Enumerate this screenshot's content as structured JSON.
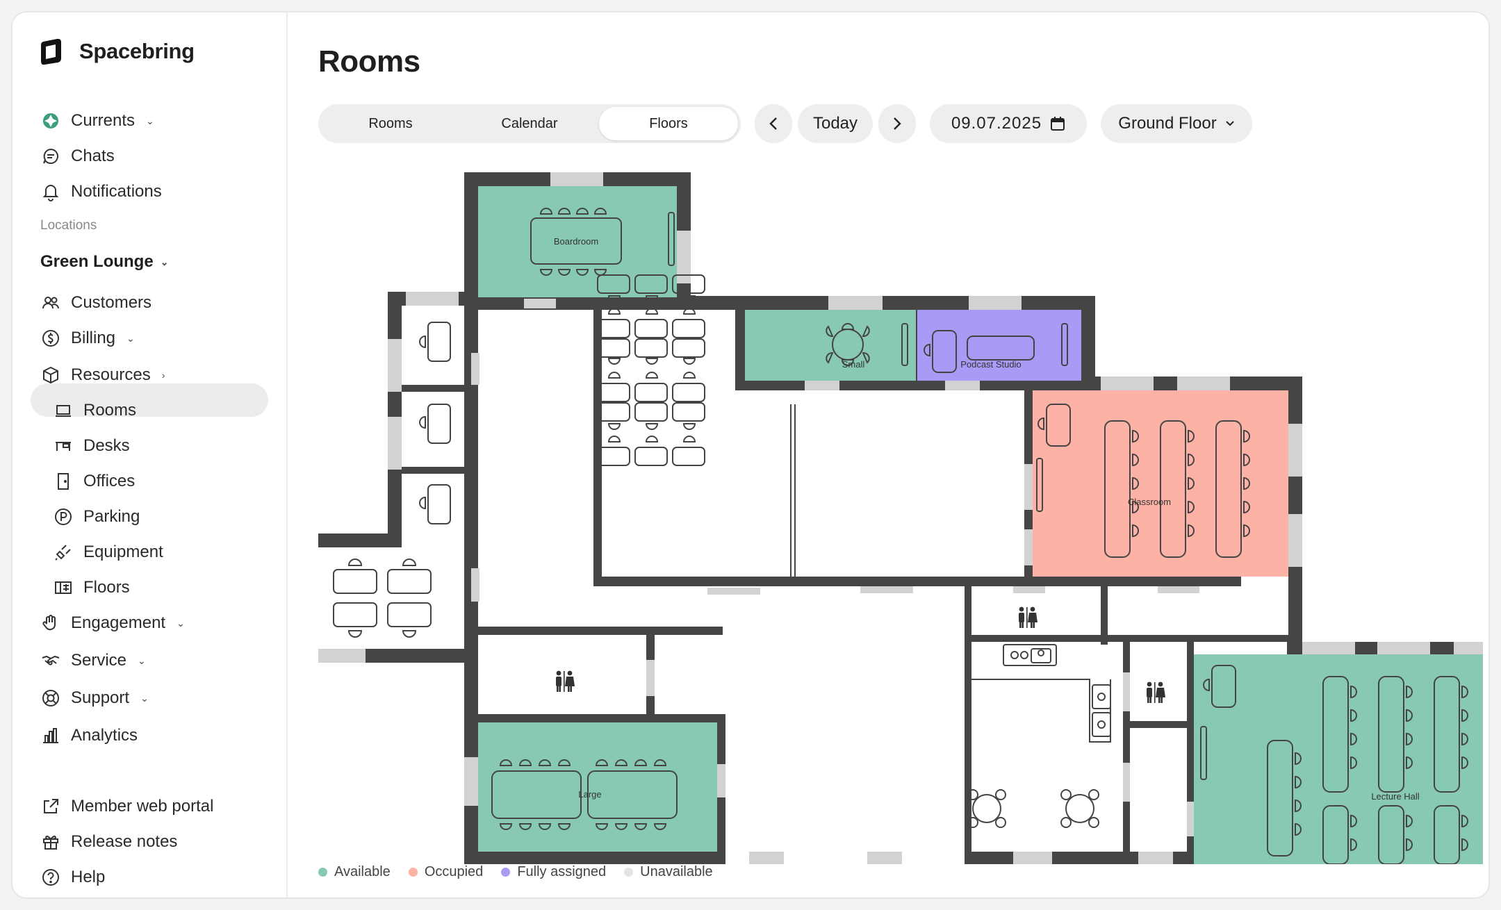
{
  "brand": {
    "name": "Spacebring"
  },
  "sidebar": {
    "top_items": [
      {
        "label": "Currents",
        "icon": "currents-icon"
      },
      {
        "label": "Chats",
        "icon": "chat-icon"
      },
      {
        "label": "Notifications",
        "icon": "bell-icon"
      }
    ],
    "locations_label": "Locations",
    "location": "Green Lounge",
    "items": [
      {
        "label": "Customers",
        "icon": "customers-icon"
      },
      {
        "label": "Billing",
        "icon": "billing-icon"
      },
      {
        "label": "Resources",
        "icon": "cube-icon"
      }
    ],
    "resources": [
      {
        "label": "Rooms",
        "icon": "room-icon"
      },
      {
        "label": "Desks",
        "icon": "desk-icon"
      },
      {
        "label": "Offices",
        "icon": "door-icon"
      },
      {
        "label": "Parking",
        "icon": "parking-icon"
      },
      {
        "label": "Equipment",
        "icon": "equipment-icon"
      },
      {
        "label": "Floors",
        "icon": "floors-icon"
      }
    ],
    "more_items": [
      {
        "label": "Engagement",
        "icon": "hand-icon"
      },
      {
        "label": "Service",
        "icon": "handshake-icon"
      },
      {
        "label": "Support",
        "icon": "lifebuoy-icon"
      },
      {
        "label": "Analytics",
        "icon": "analytics-icon"
      }
    ],
    "footer": [
      {
        "label": "Member web portal",
        "icon": "external-link-icon"
      },
      {
        "label": "Release notes",
        "icon": "gift-icon"
      },
      {
        "label": "Help",
        "icon": "help-icon"
      }
    ]
  },
  "main": {
    "title": "Rooms",
    "tabs": [
      "Rooms",
      "Calendar",
      "Floors"
    ],
    "active_tab": "Floors",
    "today_label": "Today",
    "date": "09.07.2025",
    "floor": "Ground Floor"
  },
  "rooms": {
    "boardroom": "Boardroom",
    "small": "Small",
    "podcast": "Podcast Studio",
    "classroom": "Classroom",
    "large": "Large",
    "lecture": "Lecture Hall"
  },
  "colors": {
    "available": "#88c9b6",
    "occupied": "#fdb2a6",
    "fully_assigned": "#a79bf6",
    "unavailable": "#ececec",
    "wall": "#454545"
  },
  "legend": [
    "Available",
    "Occupied",
    "Fully assigned",
    "Unavailable"
  ]
}
